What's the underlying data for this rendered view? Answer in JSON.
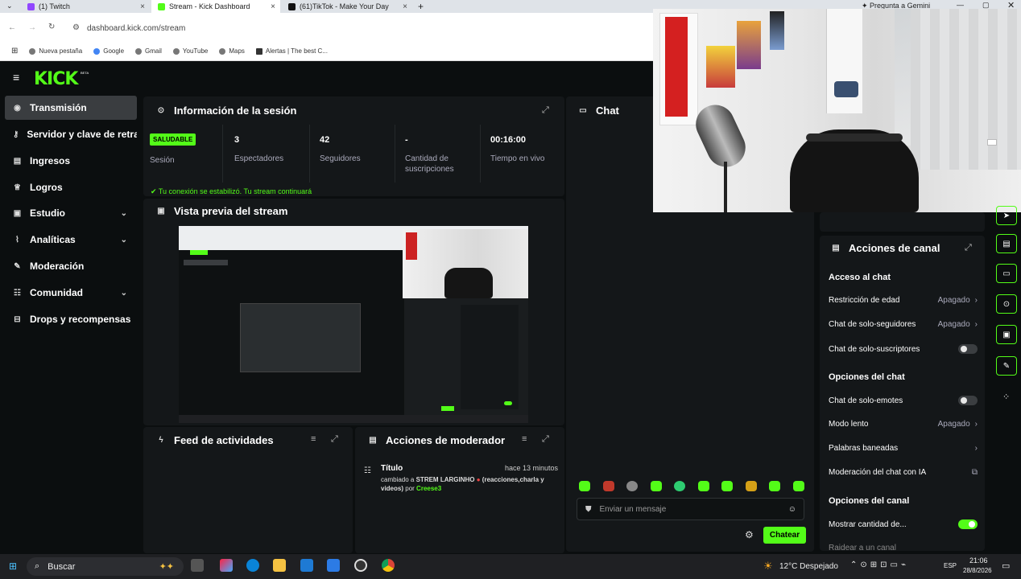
{
  "browser": {
    "tabs": [
      {
        "label": "(1) Twitch",
        "color": "#9146ff"
      },
      {
        "label": "Stream - Kick Dashboard",
        "color": "#53fc18"
      },
      {
        "label": "(61)TikTok - Make Your Day",
        "color": "#111111"
      }
    ],
    "gemini": "Pregunta a Gemini",
    "url": "dashboard.kick.com/stream",
    "bookmarks": [
      "Nueva pestaña",
      "Google",
      "Gmail",
      "YouTube",
      "Maps",
      "Alertas | The best C..."
    ]
  },
  "kick": {
    "logo": "KICK",
    "logo_tag": "BETA",
    "accent": "#53fc18"
  },
  "sidebar": {
    "items": [
      {
        "label": "Transmisión",
        "icon": "broadcast-icon"
      },
      {
        "label": "Servidor y clave de retransmisión",
        "icon": "key-icon"
      },
      {
        "label": "Ingresos",
        "icon": "money-icon"
      },
      {
        "label": "Logros",
        "icon": "trophy-icon"
      },
      {
        "label": "Estudio",
        "icon": "studio-icon"
      },
      {
        "label": "Analíticas",
        "icon": "analytics-icon"
      },
      {
        "label": "Moderación",
        "icon": "wrench-icon"
      },
      {
        "label": "Comunidad",
        "icon": "community-icon"
      },
      {
        "label": "Drops y recompensas",
        "icon": "gift-icon"
      }
    ]
  },
  "session": {
    "title": "Información de la sesión",
    "status_badge": "SALUDABLE",
    "status_label": "Sesión",
    "stats": [
      {
        "value": "3",
        "label": "Espectadores"
      },
      {
        "value": "42",
        "label": "Seguidores"
      },
      {
        "value": "-",
        "label": "Cantidad de suscripciones"
      },
      {
        "value": "00:16:00",
        "label": "Tiempo en vivo"
      }
    ],
    "message": "Tu conexión se estabilizó. Tu stream continuará"
  },
  "preview": {
    "title": "Vista previa del stream"
  },
  "chat": {
    "title": "Chat",
    "placeholder": "Enviar un mensaje",
    "send_label": "Chatear"
  },
  "activity": {
    "title": "Feed de actividades"
  },
  "mod_actions": {
    "title": "Acciones de moderador",
    "entry": {
      "heading": "Título",
      "time": "hace 13 minutos",
      "prefix": "cambiado a",
      "value": "STREM LARGINHO",
      "suffix": "(reacciones,charla y videos)",
      "by": "por",
      "user": "Creese3"
    }
  },
  "channel_actions": {
    "title": "Acciones de canal",
    "sections": {
      "chat_access": "Acceso al chat",
      "chat_options": "Opciones del chat",
      "channel_options": "Opciones del canal"
    },
    "age": {
      "label": "Restricción de edad",
      "value": "Apagado"
    },
    "followers": {
      "label": "Chat de solo-seguidores",
      "value": "Apagado"
    },
    "subs": {
      "label": "Chat de solo-suscriptores"
    },
    "emotes": {
      "label": "Chat de solo-emotes"
    },
    "slow": {
      "label": "Modo lento",
      "value": "Apagado"
    },
    "banned": {
      "label": "Palabras baneadas"
    },
    "ai": {
      "label": "Moderación del chat con IA"
    },
    "show_count": {
      "label": "Mostrar cantidad de..."
    },
    "raid": {
      "label": "Raidear a un canal"
    }
  },
  "taskbar": {
    "search": "Buscar",
    "weather": "12°C  Despejado",
    "lang": "ESP",
    "time": "21:06",
    "date": "28/8/2026"
  }
}
